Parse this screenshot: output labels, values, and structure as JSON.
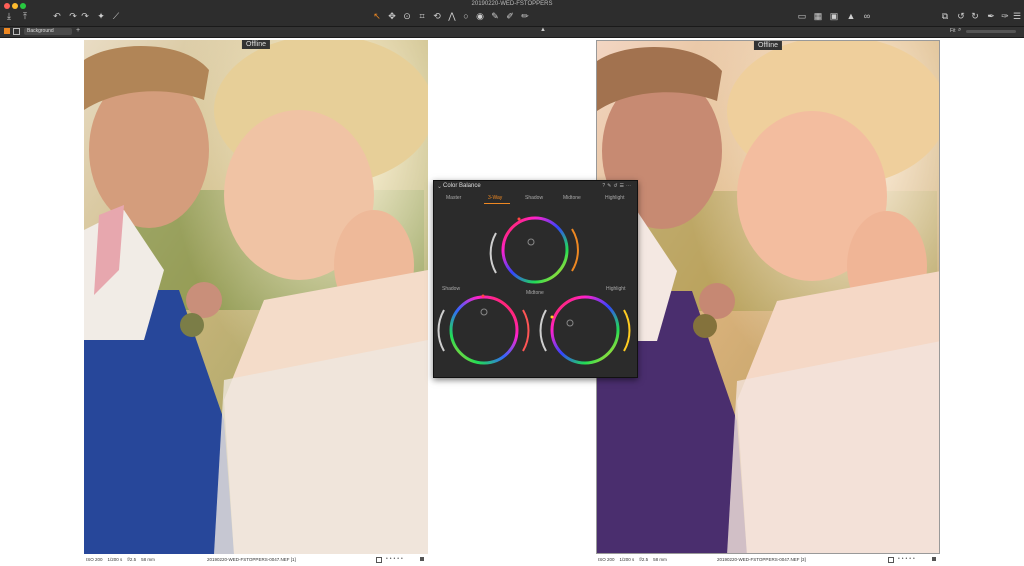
{
  "window": {
    "title": "20190220-WED-FSTOPPERS"
  },
  "toolbar": {
    "background_label": "Background",
    "fit_label": "Fit"
  },
  "viewer": {
    "left": {
      "status": "Offline",
      "iso": "ISO 200",
      "shutter": "1/200 s",
      "aperture": "f/2.5",
      "focal": "58 mm",
      "filename": "20190220-WED-FSTOPPERS-0047.NEF [1]"
    },
    "right": {
      "status": "Offline",
      "iso": "ISO 200",
      "shutter": "1/200 s",
      "aperture": "f/2.5",
      "focal": "58 mm",
      "filename": "20190220-WED-FSTOPPERS-0047.NEF [3]"
    }
  },
  "panel": {
    "title": "Color Balance",
    "tabs": [
      "Master",
      "3-Way",
      "Shadow",
      "Midtone",
      "Highlight"
    ],
    "active_tab": "3-Way",
    "wheel_labels": {
      "shadow": "Shadow",
      "midtone": "Midtone",
      "highlight": "Highlight"
    }
  },
  "colors": {
    "accent": "#ee8822",
    "chrome": "#2d2d2d",
    "panel": "#2b2b2b"
  }
}
